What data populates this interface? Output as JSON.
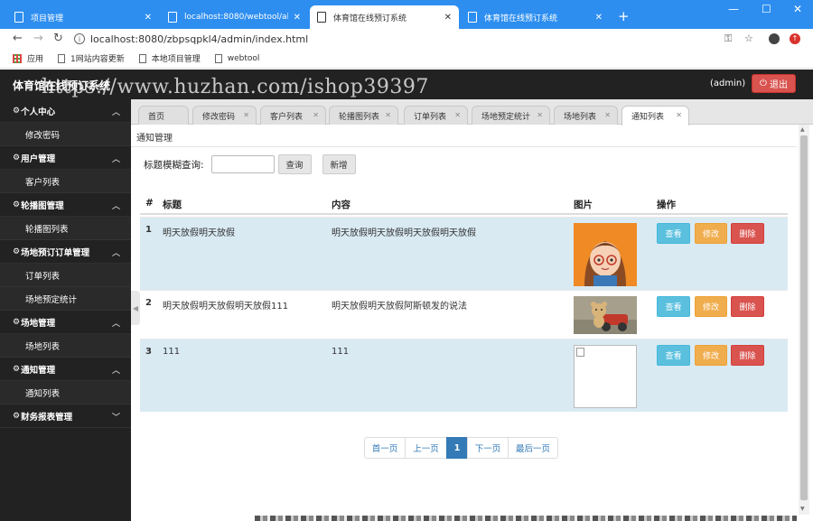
{
  "browser": {
    "tabs": [
      {
        "title": "项目管理",
        "active": false
      },
      {
        "title": "localhost:8080/webtool/all/ind",
        "active": false
      },
      {
        "title": "体育馆在线预订系统",
        "active": true
      },
      {
        "title": "体育馆在线预订系统",
        "active": false
      }
    ],
    "url": "localhost:8080/zbpsqpkl4/admin/index.html",
    "bookmarks": [
      "应用",
      "1网站内容更新",
      "本地项目管理",
      "webtool"
    ]
  },
  "header": {
    "app_name": "体育馆在线预订系统",
    "watermark": "https://www.huzhan.com/ishop39397",
    "user": "(admin)",
    "logout_label": "退出"
  },
  "sidebar": {
    "groups": [
      {
        "label": "个人中心",
        "expanded": true,
        "items": [
          "修改密码"
        ]
      },
      {
        "label": "用户管理",
        "expanded": true,
        "items": [
          "客户列表"
        ]
      },
      {
        "label": "轮播图管理",
        "expanded": true,
        "items": [
          "轮播图列表"
        ]
      },
      {
        "label": "场地预订订单管理",
        "expanded": true,
        "items": [
          "订单列表",
          "场地预定统计"
        ]
      },
      {
        "label": "场地管理",
        "expanded": true,
        "items": [
          "场地列表"
        ]
      },
      {
        "label": "通知管理",
        "expanded": true,
        "items": [
          "通知列表"
        ]
      },
      {
        "label": "财务报表管理",
        "expanded": false,
        "items": []
      }
    ]
  },
  "page_tabs": [
    "首页",
    "修改密码",
    "客户列表",
    "轮播图列表",
    "订单列表",
    "场地预定统计",
    "场地列表",
    "通知列表"
  ],
  "active_page_tab": "通知列表",
  "breadcrumb": "通知管理",
  "search": {
    "label": "标题模糊查询:",
    "value": "",
    "query_button": "查询",
    "add_button": "新增"
  },
  "table": {
    "columns": [
      "#",
      "标题",
      "内容",
      "图片",
      "操作"
    ],
    "rows": [
      {
        "num": "1",
        "title": "明天放假明天放假",
        "content": "明天放假明天放假明天放假明天放假",
        "image": "cartoon-girl-avatar"
      },
      {
        "num": "2",
        "title": "明天放假明天放假明天放假111",
        "content": "明天放假明天放假阿斯顿发的说法",
        "image": "teddy-bear-toy-car-photo"
      },
      {
        "num": "3",
        "title": "111",
        "content": "111",
        "image": "broken-image"
      }
    ],
    "actions": {
      "view": "查看",
      "edit": "修改",
      "delete": "删除"
    }
  },
  "pagination": {
    "first": "首一页",
    "prev": "上一页",
    "current": "1",
    "next": "下一页",
    "last": "最后一页"
  },
  "colors": {
    "browser_tabbar": "#2d8ef0",
    "header_bg": "#222222",
    "danger": "#d9534f",
    "info": "#5bc0de",
    "warning": "#f0ad4e",
    "primary": "#337ab7",
    "row_stripe": "#d9eaf3"
  }
}
